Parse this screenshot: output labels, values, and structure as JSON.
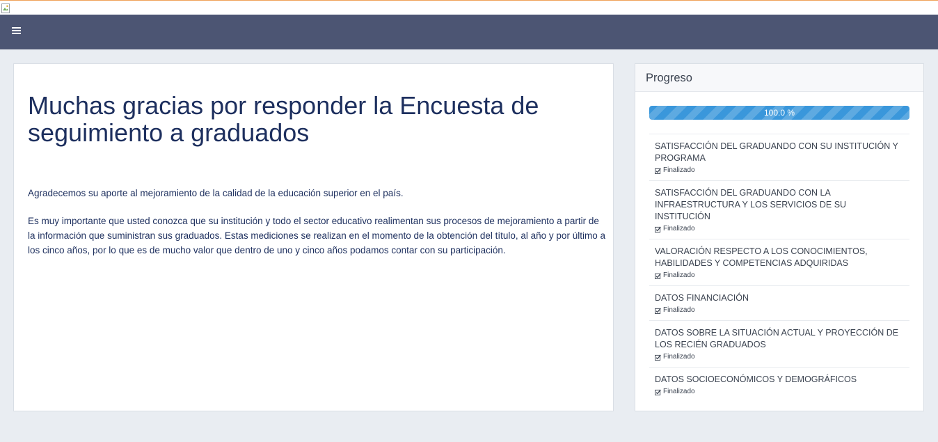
{
  "navbar": {
    "menu_icon": "hamburger-menu-icon"
  },
  "main": {
    "title": "Muchas gracias por responder la Encuesta de seguimiento a graduados",
    "paragraph_1": "Agradecemos su aporte al mejoramiento de la calidad de la educación superior en el país.",
    "paragraph_2": "Es muy importante que usted conozca que su institución y todo el sector educativo realimentan sus procesos de mejoramiento a partir de la información que suministran sus graduados. Estas mediciones se realizan en el momento de la obtención del título, al año y por último a los cinco años, por lo que es de mucho valor que dentro de uno y cinco años podamos contar con su participación."
  },
  "sidebar": {
    "title": "Progreso",
    "progress": {
      "value": 100.0,
      "label": "100.0 %"
    },
    "sections": [
      {
        "name": "SATISFACCIÓN DEL GRADUANDO CON SU INSTITUCIÓN Y PROGRAMA",
        "status": "Finalizado"
      },
      {
        "name": "SATISFACCIÓN DEL GRADUANDO CON LA INFRAESTRUCTURA Y LOS SERVICIOS DE SU INSTITUCIÓN",
        "status": "Finalizado"
      },
      {
        "name": "VALORACIÓN RESPECTO A LOS CONOCIMIENTOS, HABILIDADES Y COMPETENCIAS ADQUIRIDAS",
        "status": "Finalizado"
      },
      {
        "name": "DATOS FINANCIACIÓN",
        "status": "Finalizado"
      },
      {
        "name": "DATOS SOBRE LA SITUACIÓN ACTUAL Y PROYECCIÓN DE LOS RECIÉN GRADUADOS",
        "status": "Finalizado"
      },
      {
        "name": "DATOS SOCIOECONÓMICOS Y DEMOGRÁFICOS",
        "status": "Finalizado"
      }
    ]
  },
  "colors": {
    "navbar": "#4c5573",
    "title_text": "#1d2f5e",
    "progress_bar": "#3a97db",
    "page_background": "#e9edf2"
  }
}
